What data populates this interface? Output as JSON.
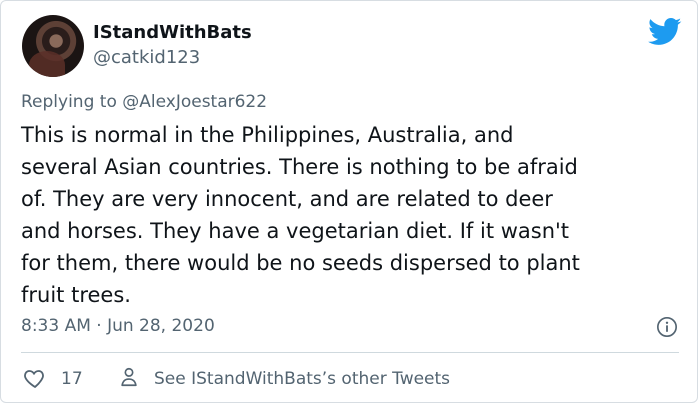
{
  "tweet": {
    "user": {
      "display_name": "IStandWithBats",
      "handle": "@catkid123"
    },
    "replying_to": "Replying to @AlexJoestar622",
    "text": "This is normal in the Philippines, Australia, and\nseveral Asian countries. There is nothing to be afraid\nof. They are very innocent, and are related to deer\nand horses. They have a vegetarian diet. If it wasn't\nfor them, there would be no seeds dispersed to plant\nfruit trees.",
    "timestamp": "8:33 AM · Jun 28, 2020",
    "like_count": "17",
    "other_tweets_label": "See IStandWithBats’s other Tweets"
  },
  "icons": {
    "brand": "twitter-bird-icon",
    "info": "info-icon",
    "like": "heart-outline-icon",
    "profile": "person-icon"
  },
  "colors": {
    "brand": "#1d9bf0",
    "text": "#0f1419",
    "secondary_text": "#536471",
    "border": "#d7dde2"
  }
}
